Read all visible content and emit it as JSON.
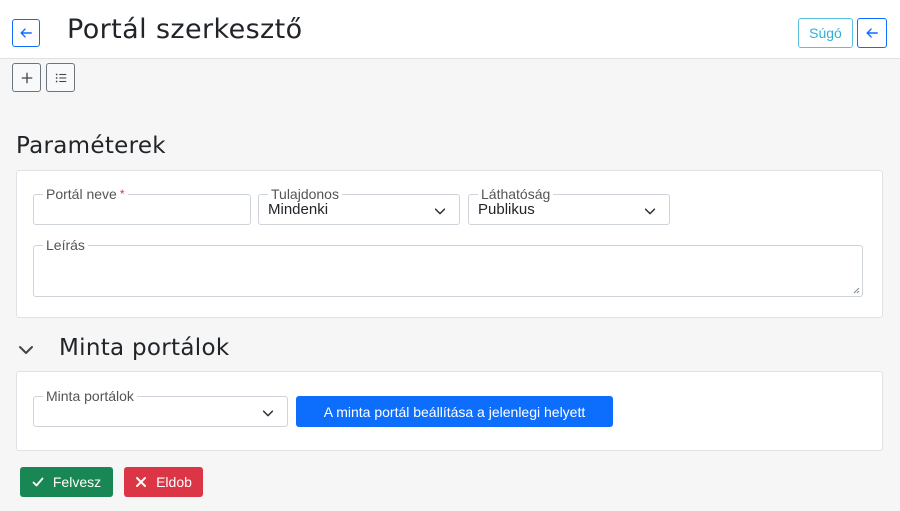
{
  "header": {
    "title": "Portál szerkesztő",
    "help_label": "Súgó",
    "back_icon": "arrow-left-icon"
  },
  "toolbar": {
    "add_icon": "plus-icon",
    "list_icon": "list-icon"
  },
  "parameters": {
    "title": "Paraméterek",
    "name": {
      "label": "Portál neve",
      "required_mark": "*",
      "value": ""
    },
    "owner": {
      "label": "Tulajdonos",
      "value": "Mindenki"
    },
    "visibility": {
      "label": "Láthatóság",
      "value": "Publikus"
    },
    "description": {
      "label": "Leírás",
      "value": ""
    }
  },
  "samples": {
    "title": "Minta portálok",
    "collapsed": false,
    "select": {
      "label": "Minta portálok",
      "value": ""
    },
    "apply_label": "A minta portál beállítása a jelenlegi helyett"
  },
  "actions": {
    "save_label": "Felvesz",
    "discard_label": "Eldob"
  },
  "colors": {
    "primary": "#0d6efd",
    "info": "#5bc0de",
    "success": "#198754",
    "danger": "#dc3545"
  }
}
